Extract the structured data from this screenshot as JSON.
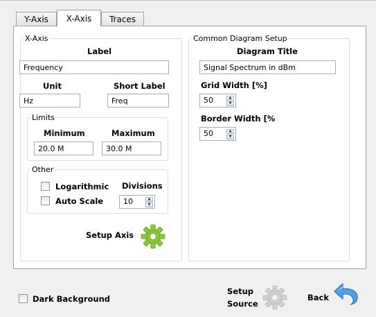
{
  "tabs": [
    {
      "label": "Y-Axis"
    },
    {
      "label": "X-Axis"
    },
    {
      "label": "Traces"
    }
  ],
  "x_axis": {
    "group_title": "X-Axis",
    "label_heading": "Label",
    "label_value": "Frequency",
    "unit_heading": "Unit",
    "unit_value": "Hz",
    "short_label_heading": "Short Label",
    "short_label_value": "Freq",
    "limits": {
      "group_title": "Limits",
      "minimum_heading": "Minimum",
      "minimum_value": "20.0 M",
      "maximum_heading": "Maximum",
      "maximum_value": "30.0 M"
    },
    "other": {
      "group_title": "Other",
      "logarithmic_label": "Logarithmic",
      "logarithmic_checked": false,
      "auto_scale_label": "Auto Scale",
      "auto_scale_checked": false,
      "divisions_heading": "Divisions",
      "divisions_value": "10"
    },
    "setup_axis_label": "Setup Axis"
  },
  "diagram": {
    "group_title": "Common Diagram Setup",
    "title_heading": "Diagram Title",
    "title_value": "Signal Spectrum in dBm",
    "grid_width_heading": "Grid Width [%]",
    "grid_width_value": "50",
    "border_width_heading": "Border Width [%",
    "border_width_value": "50"
  },
  "footer": {
    "dark_background_label": "Dark Background",
    "dark_background_checked": false,
    "setup_source_line1": "Setup",
    "setup_source_line2": "Source",
    "back_label": "Back"
  },
  "colors": {
    "gear_active": "#8ac73a",
    "gear_disabled": "#cfcfcf",
    "back_arrow": "#4f9fe6"
  }
}
